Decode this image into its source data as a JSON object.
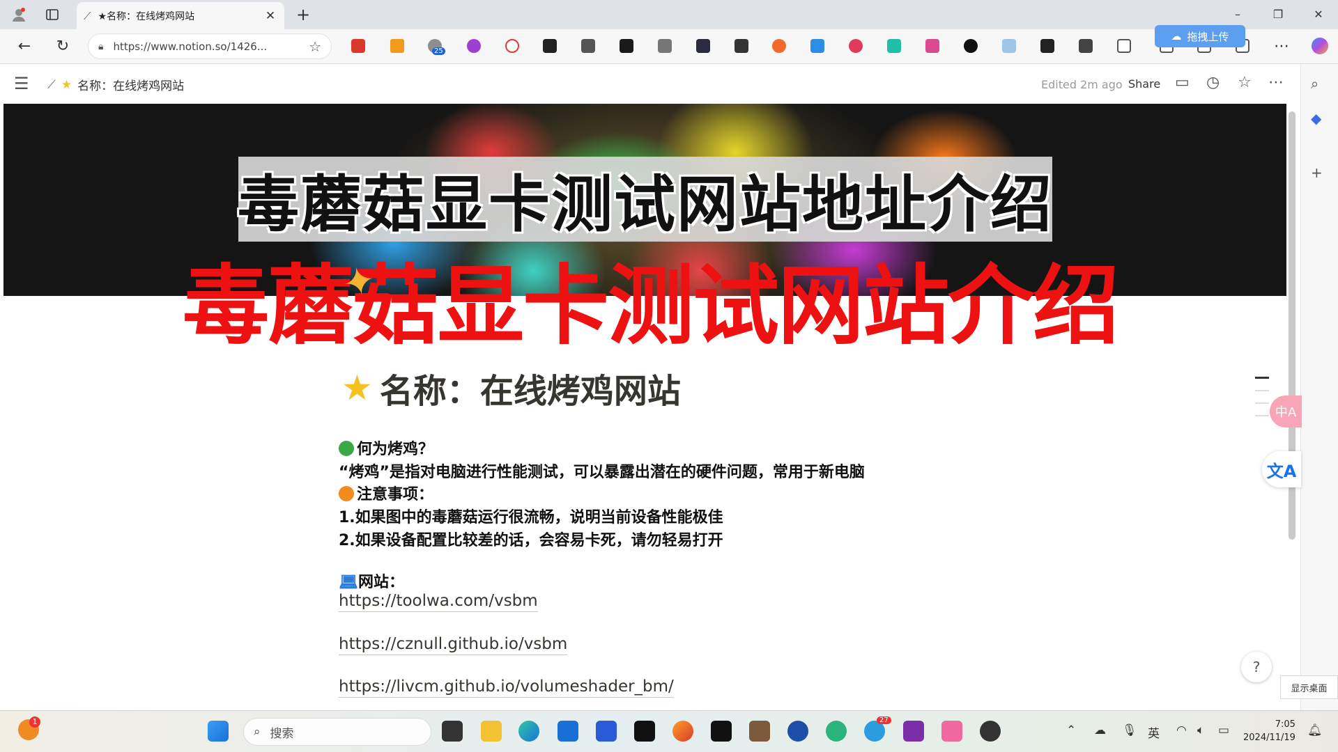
{
  "browser": {
    "tab_title": "★名称：在线烤鸡网站",
    "url": "https://www.notion.so/1426...",
    "upload_label": "拖拽上传",
    "badge_count": "25"
  },
  "notion": {
    "breadcrumb": "名称：在线烤鸡网站",
    "edited": "Edited 2m ago",
    "share": "Share"
  },
  "cover": {
    "banner_text": "毒蘑菇显卡测试网站地址介绍",
    "overlay_text": "毒蘑菇显卡测试网站介绍"
  },
  "page": {
    "title": "名称：在线烤鸡网站",
    "q_heading": "何为烤鸡？",
    "q_body": "“烤鸡”是指对电脑进行性能测试，可以暴露出潜在的硬件问题，常用于新电脑",
    "note_heading": "注意事项：",
    "note_1": "1.如果图中的毒蘑菇运行很流畅，说明当前设备性能极佳",
    "note_2": "2.如果设备配置比较差的话，会容易卡死，请勿轻易打开",
    "sites_heading": "网站：",
    "links": [
      "https://toolwa.com/vsbm",
      "https://cznull.github.io/vsbm",
      "https://livcm.github.io/volumeshader_bm/"
    ]
  },
  "widgets": {
    "translate_pink": "中A",
    "translate": "文A",
    "show_desktop": "显示桌面"
  },
  "taskbar": {
    "search_placeholder": "搜索",
    "ime": "英",
    "time": "7:05",
    "date": "2024/11/19",
    "notif_badge": "1",
    "telegram_badge": "27"
  },
  "colors": {
    "red_overlay": "#ee1111",
    "green_dot": "#3aa845",
    "orange_dot": "#f28a1d",
    "star": "#f6c01e"
  }
}
